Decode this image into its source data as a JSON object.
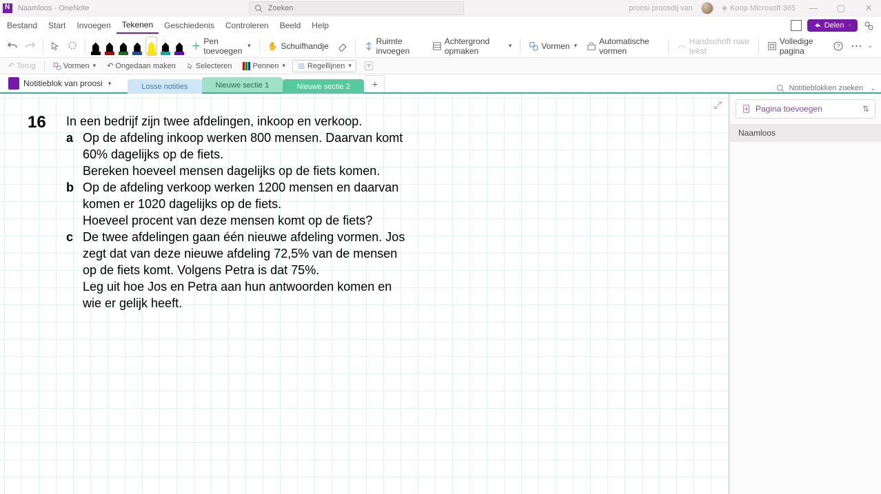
{
  "titlebar": {
    "title": "Naamloos  -  OneNote",
    "search_placeholder": "Zoeken",
    "username": "proosi proosdij van",
    "buy_label": "Koop Microsoft 365"
  },
  "menubar": {
    "tabs": [
      "Bestand",
      "Start",
      "Invoegen",
      "Tekenen",
      "Geschiedenis",
      "Controleren",
      "Beeld",
      "Help"
    ],
    "active_index": 3,
    "share_label": "Delen"
  },
  "ribbon": {
    "add_pen": "Pen toevoegen",
    "slide_handle": "Schuifhandje",
    "insert_space": "Ruimte invoegen",
    "format_bg": "Achtergrond opmaken",
    "shapes": "Vormen",
    "auto_shapes": "Automatische vormen",
    "ink_to_text": "Handschrift naar tekst",
    "full_page": "Volledige pagina",
    "pen_colors": [
      "#000000",
      "#c00000",
      "#1a6b1a",
      "#1f4ea8",
      "#ffe600",
      "#00b0a0",
      "#6a00d0"
    ],
    "selected_pen_index": 4
  },
  "qat": {
    "back": "Terug",
    "shapes": "Vormen",
    "undo": "Ongedaan maken",
    "select": "Selecteren",
    "pens": "Pennen",
    "rule_lines": "Regellijnen"
  },
  "sectionbar": {
    "notebook_label": "Notitieblok van proosi",
    "tabs": [
      {
        "label": "Losse notities",
        "style": "blue"
      },
      {
        "label": "Nieuwe sectie 1",
        "style": "teal1"
      },
      {
        "label": "Nieuwe sectie 2",
        "style": "teal2"
      }
    ],
    "search_placeholder": "Notitieblokken zoeken"
  },
  "pagepane": {
    "add_page": "Pagina toevoegen",
    "pages": [
      "Naamloos"
    ]
  },
  "note": {
    "number": "16",
    "intro": "In een bedrijf zijn twee afdelingen, inkoop en verkoop.",
    "items": [
      {
        "letter": "a",
        "text": "Op de afdeling inkoop werken 800 mensen. Daarvan komt 60% dagelijks op de fiets.\nBereken hoeveel mensen dagelijks op de fiets komen."
      },
      {
        "letter": "b",
        "text": "Op de afdeling verkoop werken 1200 mensen en daarvan komen er 1020 dagelijks op de fiets.\nHoeveel procent van deze mensen komt op de fiets?"
      },
      {
        "letter": "c",
        "text": "De twee afdelingen gaan één nieuwe afdeling vormen. Jos zegt dat van deze nieuwe afdeling 72,5% van de mensen op de fiets komt. Volgens Petra is dat 75%.\nLeg uit hoe Jos en Petra aan hun antwoorden komen en wie er gelijk heeft."
      }
    ]
  }
}
